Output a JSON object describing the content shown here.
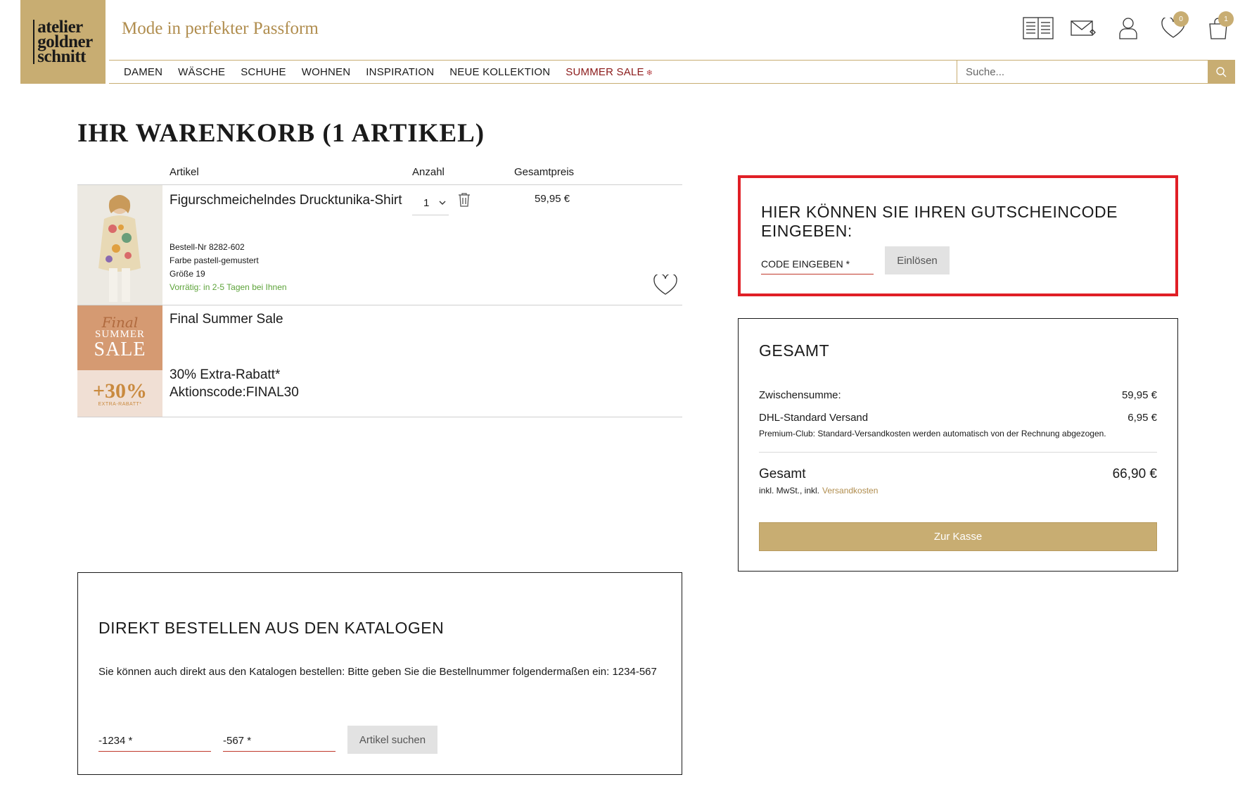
{
  "brand": {
    "logo_line1": "atelier",
    "logo_line2": "goldner",
    "logo_line3": "schnitt",
    "tagline": "Mode in perfekter Passform",
    "accent_color": "#c8ad72"
  },
  "header": {
    "icons": [
      "catalog-icon",
      "newsletter-icon",
      "account-icon",
      "wishlist-icon",
      "cart-icon"
    ],
    "wishlist_count": "0",
    "cart_count": "1"
  },
  "nav": {
    "items": [
      {
        "label": "DAMEN"
      },
      {
        "label": "WÄSCHE"
      },
      {
        "label": "SCHUHE"
      },
      {
        "label": "WOHNEN"
      },
      {
        "label": "INSPIRATION"
      },
      {
        "label": "NEUE KOLLEKTION"
      },
      {
        "label": "SUMMER SALE"
      }
    ],
    "sale_symbol": "❄"
  },
  "search": {
    "placeholder": "Suche..."
  },
  "cart": {
    "title": "IHR WARENKORB (1 ARTIKEL)",
    "columns": {
      "artikel": "Artikel",
      "anzahl": "Anzahl",
      "gesamtpreis": "Gesamtpreis"
    },
    "item": {
      "name": "Figurschmeichelndes Drucktunika-Shirt",
      "quantity": "1",
      "price": "59,95 €",
      "order_no": "Bestell-Nr 8282-602",
      "color": "Farbe pastell-gemustert",
      "size": "Größe 19",
      "stock": "Vorrätig: in 2-5 Tagen bei Ihnen"
    },
    "promo": {
      "title": "Final Summer Sale",
      "line1": "30% Extra-Rabatt*",
      "line2": "Aktionscode:FINAL30",
      "badge_final": "Final",
      "badge_summer": "SUMMER",
      "badge_sale": "SALE",
      "badge_pct": "+30%",
      "badge_extra": "EXTRA-RABATT*"
    }
  },
  "coupon": {
    "title": "HIER KÖNNEN SIE IHREN GUTSCHEINCODE EINGEBEN:",
    "field_label": "CODE EINGEBEN *",
    "button": "Einlösen",
    "highlight_color": "#e01f26"
  },
  "totals": {
    "title": "GESAMT",
    "subtotal_label": "Zwischensumme:",
    "subtotal_value": "59,95 €",
    "shipping_label": "DHL-Standard Versand",
    "shipping_value": "6,95 €",
    "premium_note": "Premium-Club: Standard-Versandkosten werden automatisch von der Rechnung abgezogen.",
    "grand_label": "Gesamt",
    "grand_value": "66,90 €",
    "tax_note": "inkl. MwSt., inkl.",
    "tax_link": "Versandkosten",
    "checkout_button": "Zur Kasse"
  },
  "catalog": {
    "title": "DIREKT BESTELLEN AUS DEN KATALOGEN",
    "description": "Sie können auch direkt aus den Katalogen bestellen: Bitte geben Sie die Bestellnummer folgendermaßen ein: 1234-567",
    "field1_label": "-1234 *",
    "field2_label": "-567 *",
    "button": "Artikel suchen"
  }
}
